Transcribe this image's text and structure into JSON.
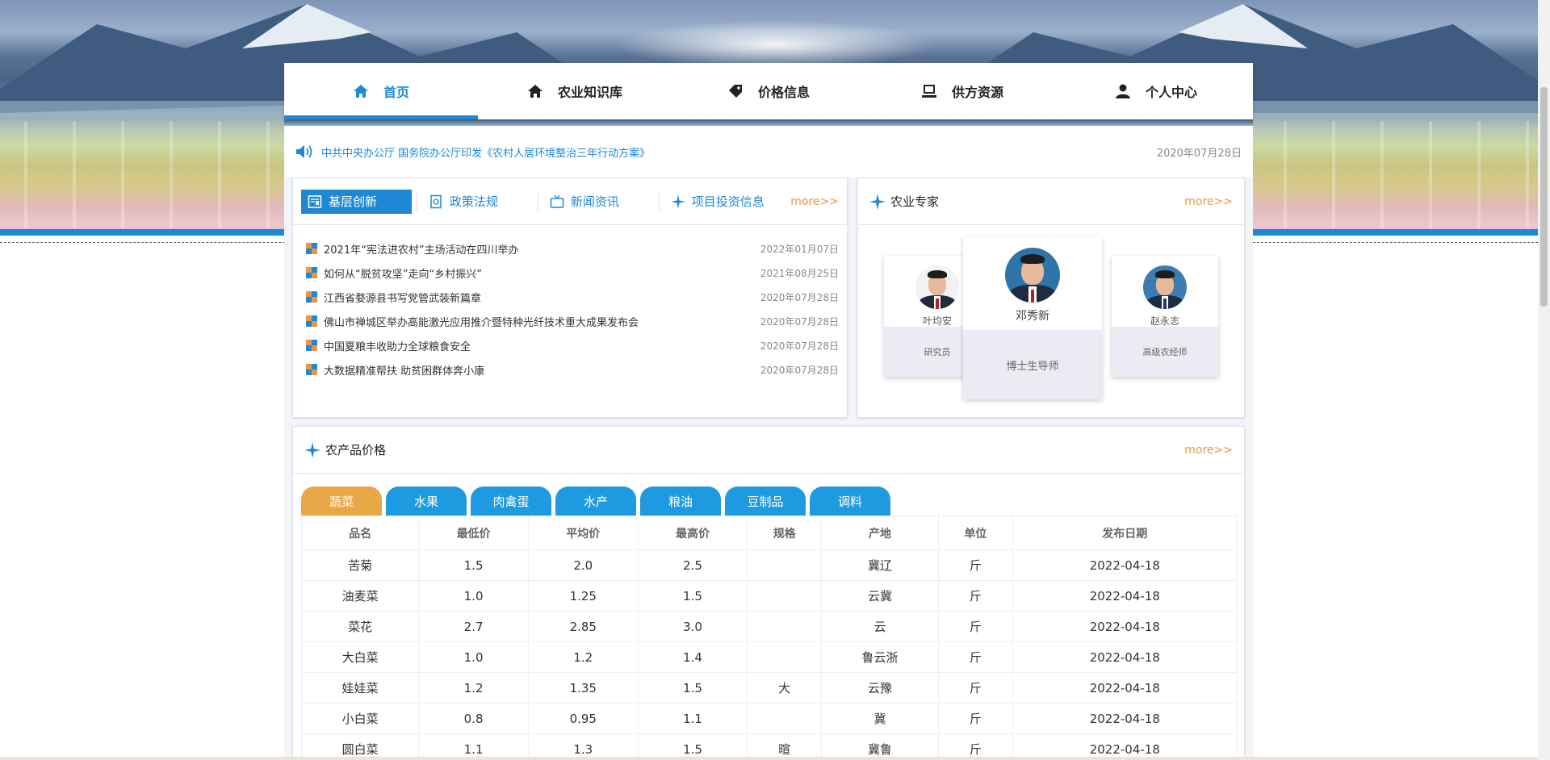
{
  "nav": {
    "items": [
      {
        "label": "首页",
        "icon": "home-icon",
        "active": true
      },
      {
        "label": "农业知识库",
        "icon": "home-icon",
        "active": false
      },
      {
        "label": "价格信息",
        "icon": "tag-icon",
        "active": false
      },
      {
        "label": "供方资源",
        "icon": "monitor-icon",
        "active": false
      },
      {
        "label": "个人中心",
        "icon": "user-icon",
        "active": false
      }
    ]
  },
  "notice": {
    "text": "中共中央办公厅 国务院办公厅印发《农村人居环境整治三年行动方案》",
    "date": "2020年07月28日"
  },
  "news": {
    "tabs": [
      "基层创新",
      "政策法规",
      "新闻资讯",
      "项目投资信息"
    ],
    "more": "more>>",
    "items": [
      {
        "title": "2021年“宪法进农村”主场活动在四川举办",
        "date": "2022年01月07日"
      },
      {
        "title": "如何从“脱贫攻坚”走向“乡村振兴”",
        "date": "2021年08月25日"
      },
      {
        "title": "江西省婺源县书写党管武装新篇章",
        "date": "2020年07月28日"
      },
      {
        "title": "佛山市禅城区举办高能激光应用推介暨特种光纤技术重大成果发布会",
        "date": "2020年07月28日"
      },
      {
        "title": "中国夏粮丰收助力全球粮食安全",
        "date": "2020年07月28日"
      },
      {
        "title": "大数据精准帮扶 助贫困群体奔小康",
        "date": "2020年07月28日"
      }
    ]
  },
  "experts": {
    "title": "农业专家",
    "more": "more>>",
    "cards": [
      {
        "name": "叶均安",
        "role": "研究员"
      },
      {
        "name": "邓秀新",
        "role": "博士生导师"
      },
      {
        "name": "赵永志",
        "role": "高级农经师"
      }
    ]
  },
  "price": {
    "title": "农产品价格",
    "more": "more>>",
    "tabs": [
      "蔬菜",
      "水果",
      "肉禽蛋",
      "水产",
      "粮油",
      "豆制品",
      "调料"
    ],
    "headers": [
      "品名",
      "最低价",
      "平均价",
      "最高价",
      "规格",
      "产地",
      "单位",
      "发布日期"
    ],
    "rows": [
      [
        "苦菊",
        "1.5",
        "2.0",
        "2.5",
        "",
        "冀辽",
        "斤",
        "2022-04-18"
      ],
      [
        "油麦菜",
        "1.0",
        "1.25",
        "1.5",
        "",
        "云冀",
        "斤",
        "2022-04-18"
      ],
      [
        "菜花",
        "2.7",
        "2.85",
        "3.0",
        "",
        "云",
        "斤",
        "2022-04-18"
      ],
      [
        "大白菜",
        "1.0",
        "1.2",
        "1.4",
        "",
        "鲁云浙",
        "斤",
        "2022-04-18"
      ],
      [
        "娃娃菜",
        "1.2",
        "1.35",
        "1.5",
        "大",
        "云豫",
        "斤",
        "2022-04-18"
      ],
      [
        "小白菜",
        "0.8",
        "0.95",
        "1.1",
        "",
        "冀",
        "斤",
        "2022-04-18"
      ],
      [
        "圆白菜",
        "1.1",
        "1.3",
        "1.5",
        "暄",
        "冀鲁",
        "斤",
        "2022-04-18"
      ]
    ]
  },
  "colors": {
    "primary": "#1e88d6",
    "accent": "#e8964a",
    "tab_active": "#e8a848",
    "tab": "#1e9be0"
  }
}
